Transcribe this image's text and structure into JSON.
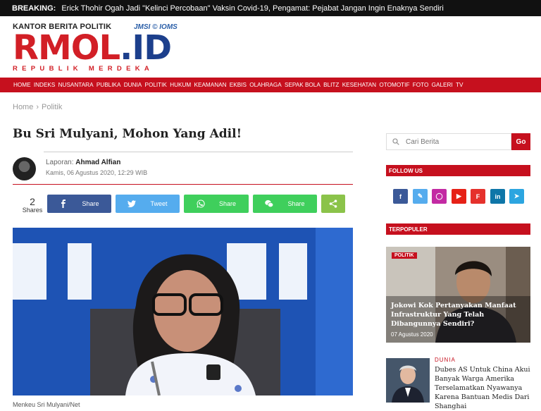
{
  "breaking": {
    "label": "BREAKING:",
    "text": "Erick Thohir Ogah Jadi \"Kelinci Percobaan\" Vaksin Covid-19, Pengamat: Pejabat Jangan Ingin Enaknya Sendiri"
  },
  "logo": {
    "top": "KANTOR BERITA POLITIK",
    "partner": "JMSI © IOMS",
    "main_a": "RMOL",
    "main_b": ".ID",
    "sub": "REPUBLIK MERDEKA"
  },
  "nav": [
    "HOME",
    "INDEKS",
    "NUSANTARA",
    "PUBLIKA",
    "DUNIA",
    "POLITIK",
    "HUKUM",
    "KEAMANAN",
    "EKBIS",
    "OLAHRAGA",
    "SEPAK BOLA",
    "BLITZ",
    "KESEHATAN",
    "OTOMOTIF",
    "FOTO",
    "GALERI",
    "TV"
  ],
  "breadcrumb": {
    "home": "Home",
    "sep": "›",
    "section": "Politik"
  },
  "article": {
    "title": "Bu Sri Mulyani, Mohon Yang Adil!",
    "reporter_label": "Laporan:",
    "reporter": "Ahmad Alfian",
    "date": "Kamis, 06 Agustus 2020, 12:29 WIB",
    "caption": "Menkeu Sri Mulyani/Net"
  },
  "share": {
    "count": "2",
    "count_label": "Shares",
    "facebook": "Share",
    "twitter": "Tweet",
    "whatsapp": "Share",
    "wechat": "Share"
  },
  "sidebar": {
    "search_placeholder": "Cari Berita",
    "search_button": "Go",
    "follow_label": "FOLLOW US",
    "popular_label": "TERPOPULER",
    "featured": {
      "badge": "POLITIK",
      "title": "Jokowi Kok Pertanyakan Manfaat Infrastruktur Yang Telah Dibangunnya Sendiri?",
      "date": "07 Agustus 2020"
    },
    "item2": {
      "category": "DUNIA",
      "title": "Dubes AS Untuk China Akui Banyak Warga Amerika Terselamatkan Nyawanya Karena Bantuan Medis Dari Shanghai"
    }
  },
  "colors": {
    "brand_red": "#c6101e",
    "brand_blue": "#1c3f8c"
  }
}
